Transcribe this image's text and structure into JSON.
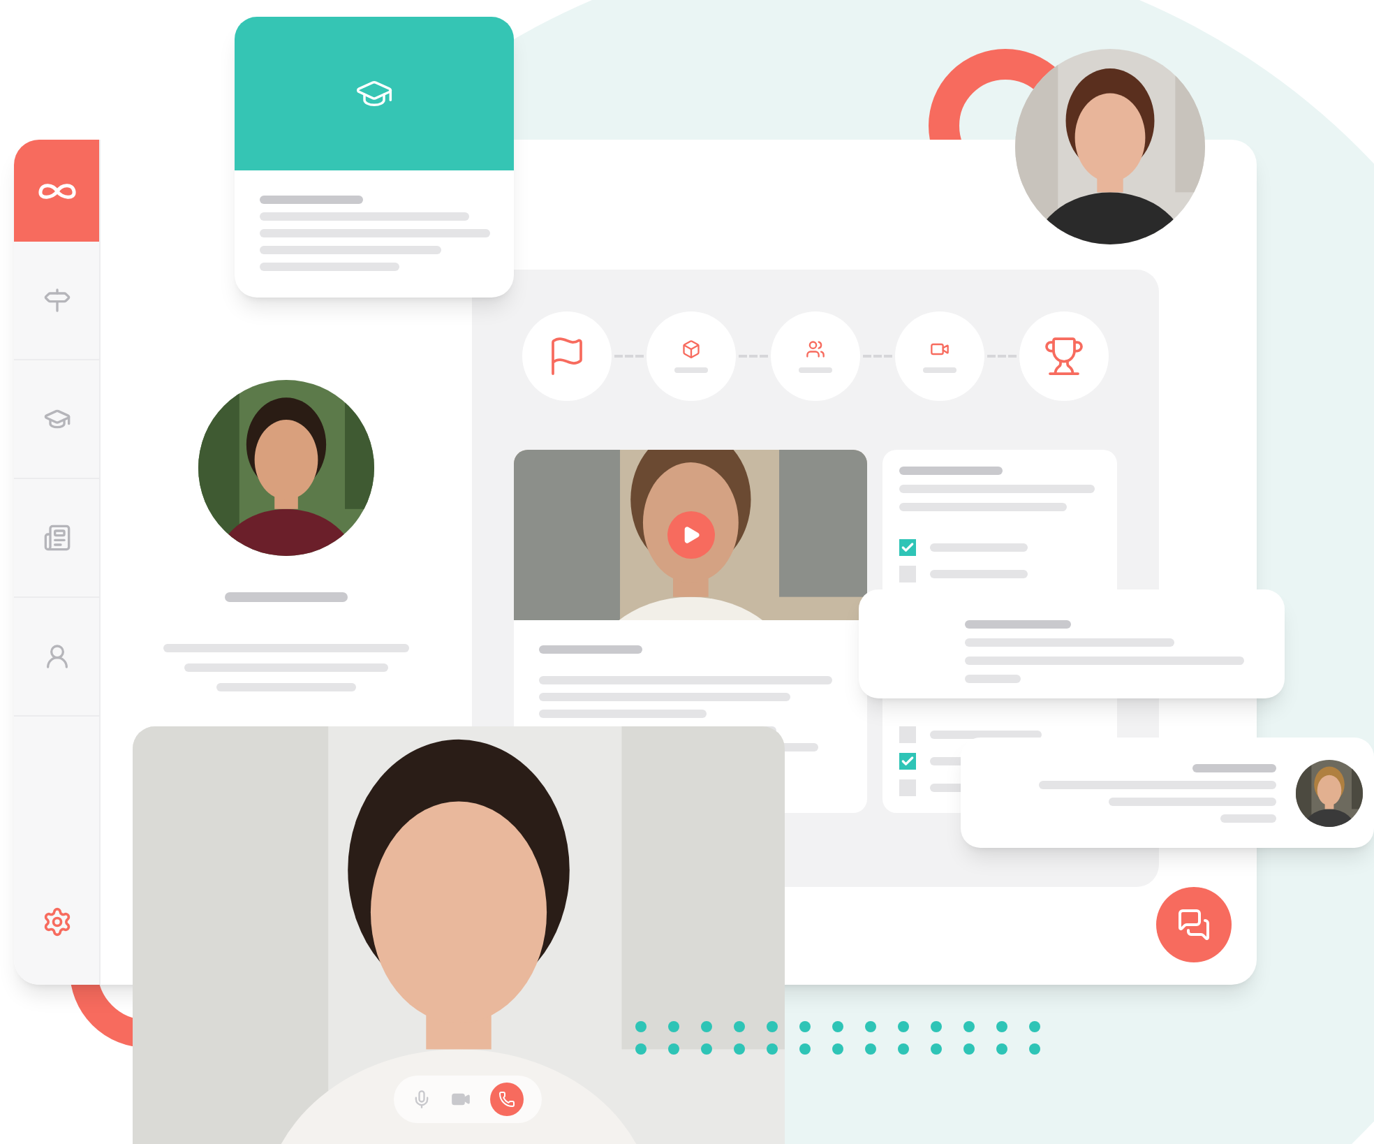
{
  "sidebar": {
    "items": [
      {
        "kind": "signpost"
      },
      {
        "kind": "cap"
      },
      {
        "kind": "list"
      },
      {
        "kind": "person"
      }
    ]
  },
  "steps": [
    {
      "kind": "flag"
    },
    {
      "kind": "box"
    },
    {
      "kind": "people"
    },
    {
      "kind": "video"
    },
    {
      "kind": "trophy"
    }
  ],
  "checklist": {
    "items": [
      {
        "checked": true
      },
      {
        "checked": false
      },
      {
        "checked": false
      },
      {
        "checked": true
      },
      {
        "checked": false
      }
    ]
  },
  "video_call": {
    "controls": [
      {
        "kind": "mic"
      },
      {
        "kind": "camera"
      },
      {
        "kind": "hangup"
      }
    ]
  }
}
